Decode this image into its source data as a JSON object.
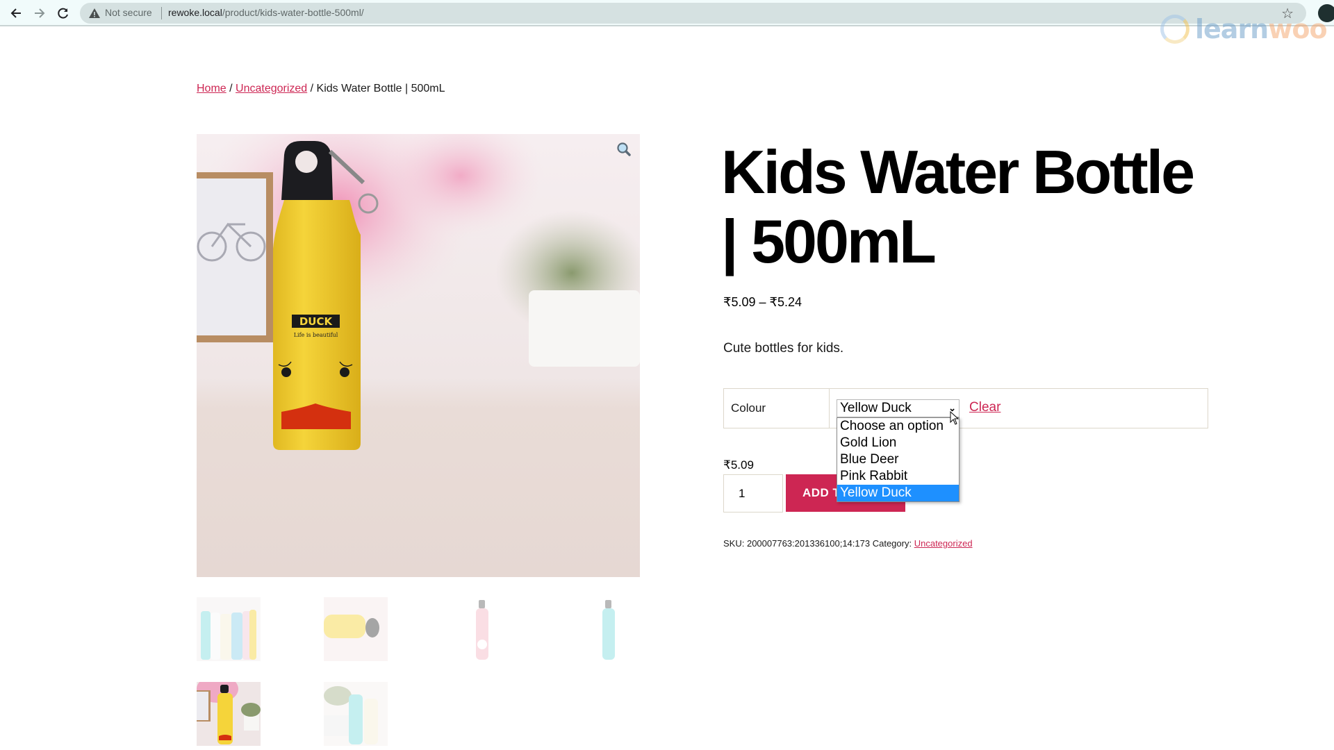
{
  "browser": {
    "security_label": "Not secure",
    "url_host": "rewoke.local",
    "url_path": "/product/kids-water-bottle-500ml/",
    "icons": [
      "back-arrow-icon",
      "forward-arrow-icon",
      "reload-icon",
      "warning-triangle-icon",
      "star-icon",
      "incognito-icon"
    ]
  },
  "watermark": {
    "part1": "learn",
    "part2": "woo"
  },
  "breadcrumb": {
    "items": [
      {
        "label": "Home",
        "link": true
      },
      {
        "label": "Uncategorized",
        "link": true
      },
      {
        "label": "Kids Water Bottle | 500mL",
        "link": false
      }
    ],
    "separator": " / "
  },
  "product": {
    "title": "Kids Water Bottle | 500mL",
    "price_range": "₹5.09 – ₹5.24",
    "short_description": "Cute bottles for kids.",
    "main_image": {
      "label": "DUCK",
      "tagline": "Life  is beautiful",
      "alt": "Yellow duck water bottle"
    },
    "thumbnails": [
      {
        "name": "multi-color-bottles",
        "active": false
      },
      {
        "name": "yellow-bottle-closeup",
        "active": false
      },
      {
        "name": "pink-rabbit-bottle",
        "active": false
      },
      {
        "name": "blue-deer-bottle",
        "active": false
      },
      {
        "name": "yellow-duck-bottle",
        "active": true
      },
      {
        "name": "blue-and-cream-bottles",
        "active": false
      }
    ],
    "variation": {
      "attribute_label": "Colour",
      "selected": "Yellow Duck",
      "options": [
        "Choose an option",
        "Gold Lion",
        "Blue Deer",
        "Pink Rabbit",
        "Yellow Duck"
      ],
      "clear_label": "Clear"
    },
    "variation_price": "₹5.09",
    "quantity": "1",
    "add_to_cart_label": "ADD TO CART",
    "meta": {
      "sku_label": "SKU:",
      "sku": "200007763:201336100;14:173",
      "category_label": "Category:",
      "category": "Uncategorized"
    }
  },
  "colors": {
    "accent": "#cd2653",
    "dropdown_highlight": "#1e90ff"
  }
}
